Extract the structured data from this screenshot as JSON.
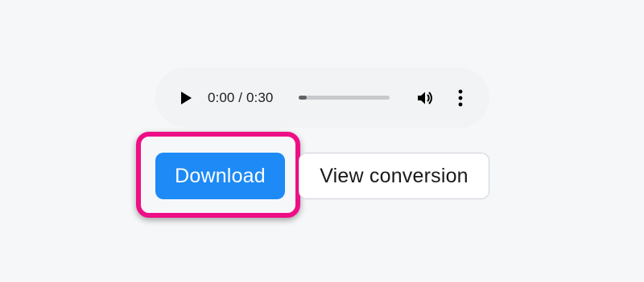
{
  "audio_player": {
    "play_icon": "play-icon",
    "current_time": "0:00",
    "duration": "0:30",
    "time_display": "0:00 / 0:30",
    "progress": 0.09,
    "volume_icon": "volume-icon",
    "more_icon": "more-options-icon"
  },
  "actions": {
    "download_label": "Download",
    "view_conversion_label": "View conversion"
  },
  "colors": {
    "download_button_bg": "#1d8af6",
    "highlight_frame": "#ee0e85",
    "player_bg": "#f1f3f4",
    "page_bg": "#f6f7f9"
  }
}
